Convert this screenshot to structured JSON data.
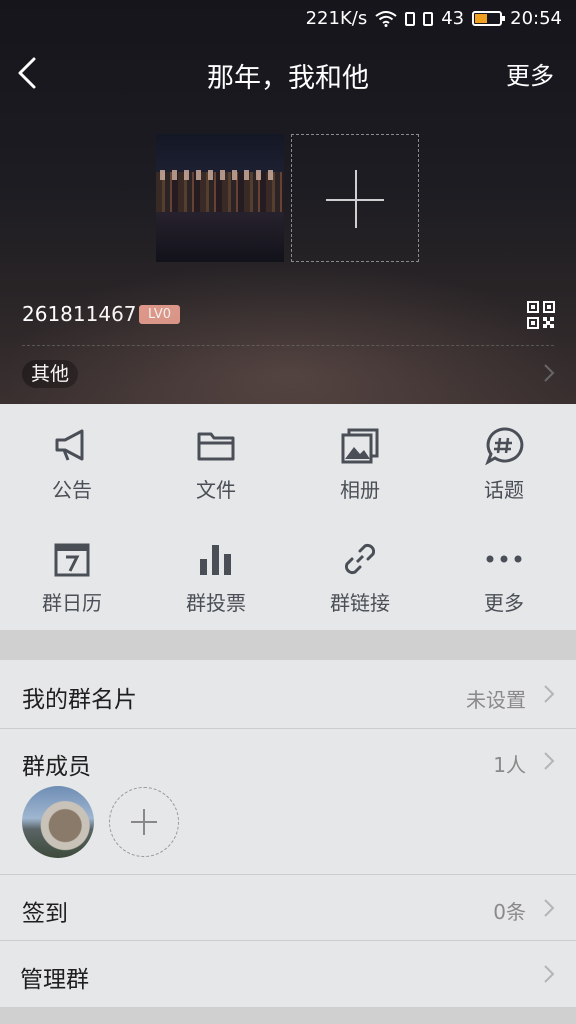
{
  "status_bar": {
    "speed": "221K/s",
    "signal": "43",
    "time": "20:54"
  },
  "navbar": {
    "title": "那年，我和他",
    "more": "更多"
  },
  "group": {
    "id": "261811467",
    "level": "LV0",
    "category": "其他"
  },
  "features": [
    {
      "label": "公告",
      "icon": "megaphone-icon"
    },
    {
      "label": "文件",
      "icon": "folder-icon"
    },
    {
      "label": "相册",
      "icon": "album-icon"
    },
    {
      "label": "话题",
      "icon": "topic-icon"
    },
    {
      "label": "群日历",
      "icon": "calendar-icon"
    },
    {
      "label": "群投票",
      "icon": "vote-icon"
    },
    {
      "label": "群链接",
      "icon": "link-icon"
    },
    {
      "label": "更多",
      "icon": "more-icon"
    }
  ],
  "rows": {
    "card": {
      "label": "我的群名片",
      "value": "未设置"
    },
    "members": {
      "label": "群成员",
      "value": "1人"
    },
    "checkin": {
      "label": "签到",
      "value": "0条"
    },
    "manage": {
      "label": "管理群"
    }
  },
  "colors": {
    "accent_icon": "#4a4f57",
    "level_badge": "#e49b8c",
    "battery": "#f0a020"
  }
}
